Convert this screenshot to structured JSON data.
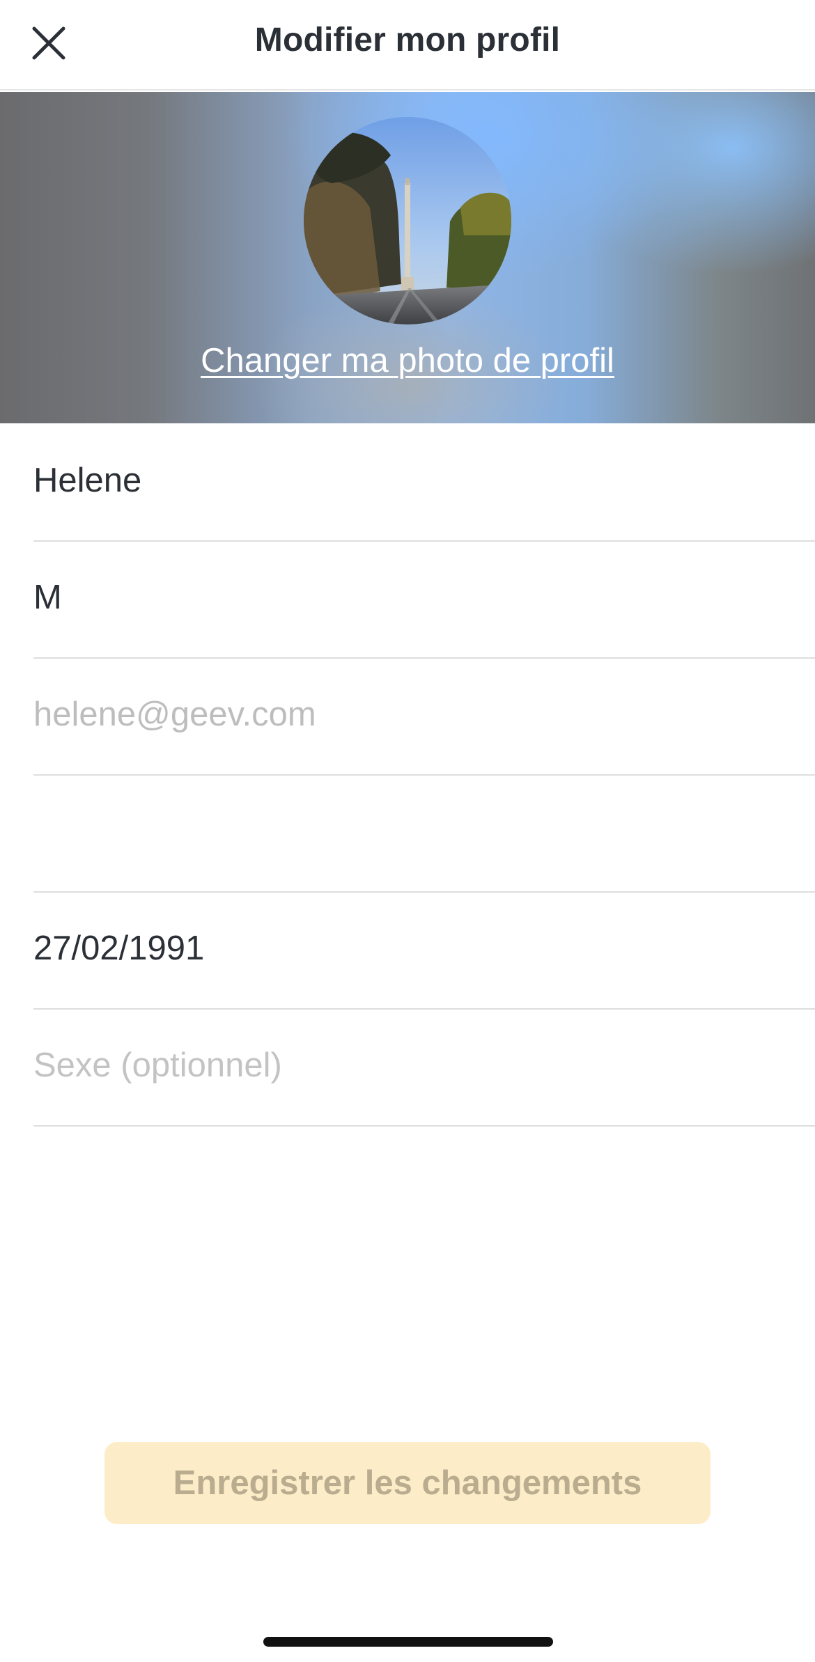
{
  "header": {
    "title": "Modifier mon profil",
    "close_icon": "close-icon"
  },
  "profile_photo": {
    "change_label": "Changer ma photo de profil"
  },
  "form": {
    "first_name": {
      "value": "Helene"
    },
    "last_name": {
      "value": "M"
    },
    "email": {
      "value": "helene@geev.com",
      "state": "disabled"
    },
    "phone": {
      "value": ""
    },
    "birth_date": {
      "value": "27/02/1991"
    },
    "gender": {
      "placeholder": "Sexe (optionnel)"
    }
  },
  "footer": {
    "save_label": "Enregistrer les changements"
  },
  "colors": {
    "title_text": "#2b2f36",
    "divider": "#dedede",
    "placeholder_text": "#c3c3c3",
    "save_button_bg": "#fcedc8",
    "save_button_text": "#b9ac8f"
  }
}
